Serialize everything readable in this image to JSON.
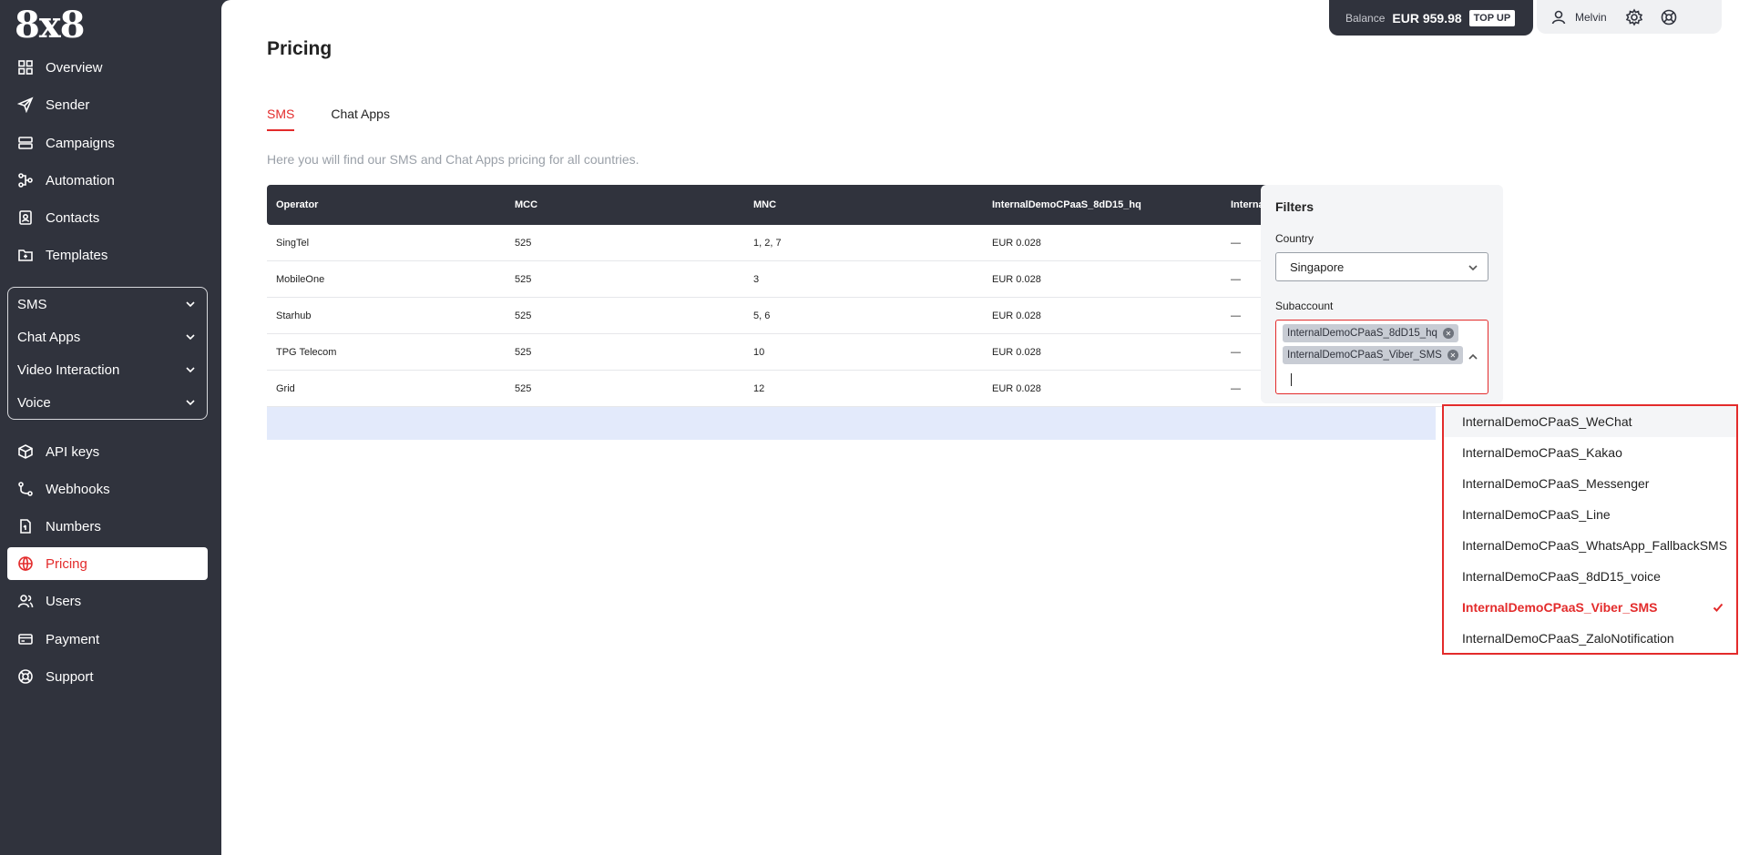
{
  "app": {
    "logo": "8x8"
  },
  "sidebar": {
    "items": [
      {
        "label": "Overview",
        "icon": "grid-icon"
      },
      {
        "label": "Sender",
        "icon": "send-icon"
      },
      {
        "label": "Campaigns",
        "icon": "campaign-icon"
      },
      {
        "label": "Automation",
        "icon": "automation-icon"
      },
      {
        "label": "Contacts",
        "icon": "contacts-icon"
      },
      {
        "label": "Templates",
        "icon": "templates-icon"
      }
    ],
    "groups": [
      "SMS",
      "Chat Apps",
      "Video Interaction",
      "Voice"
    ],
    "items_bottom": [
      {
        "label": "API keys",
        "icon": "cube-icon"
      },
      {
        "label": "Webhooks",
        "icon": "webhook-icon"
      },
      {
        "label": "Numbers",
        "icon": "numbers-icon"
      },
      {
        "label": "Pricing",
        "icon": "globe-icon",
        "active": true
      },
      {
        "label": "Users",
        "icon": "users-icon"
      },
      {
        "label": "Payment",
        "icon": "card-icon"
      },
      {
        "label": "Support",
        "icon": "support-icon"
      }
    ]
  },
  "topbar": {
    "balance_label": "Balance",
    "balance_value": "EUR 959.98",
    "topup_label": "TOP UP",
    "user_name": "Melvin"
  },
  "page": {
    "title": "Pricing",
    "tabs": [
      {
        "label": "SMS",
        "active": true
      },
      {
        "label": "Chat Apps",
        "active": false
      }
    ],
    "subtitle": "Here you will find our SMS and Chat Apps pricing for all countries."
  },
  "table": {
    "columns": [
      "Operator",
      "MCC",
      "MNC",
      "InternalDemoCPaaS_8dD15_hq",
      "InternalDemoCPaaS_Viber_SMS"
    ],
    "rows": [
      [
        "SingTel",
        "525",
        "1, 2, 7",
        "EUR 0.028",
        "—"
      ],
      [
        "MobileOne",
        "525",
        "3",
        "EUR 0.028",
        "—"
      ],
      [
        "Starhub",
        "525",
        "5, 6",
        "EUR 0.028",
        "—"
      ],
      [
        "TPG Telecom",
        "525",
        "10",
        "EUR 0.028",
        "—"
      ],
      [
        "Grid",
        "525",
        "12",
        "EUR 0.028",
        "—"
      ]
    ]
  },
  "filters": {
    "title": "Filters",
    "country_label": "Country",
    "country_value": "Singapore",
    "subaccount_label": "Subaccount",
    "subaccount_chips": [
      "InternalDemoCPaaS_8dD15_hq",
      "InternalDemoCPaaS_Viber_SMS"
    ]
  },
  "dropdown": {
    "options": [
      {
        "label": "InternalDemoCPaaS_WeChat",
        "state": "hover"
      },
      {
        "label": "InternalDemoCPaaS_Kakao",
        "state": ""
      },
      {
        "label": "InternalDemoCPaaS_Messenger",
        "state": ""
      },
      {
        "label": "InternalDemoCPaaS_Line",
        "state": ""
      },
      {
        "label": "InternalDemoCPaaS_WhatsApp_FallbackSMS",
        "state": ""
      },
      {
        "label": "InternalDemoCPaaS_8dD15_voice",
        "state": ""
      },
      {
        "label": "InternalDemoCPaaS_Viber_SMS",
        "state": "selected"
      },
      {
        "label": "InternalDemoCPaaS_ZaloNotification",
        "state": ""
      }
    ]
  },
  "colors": {
    "accent": "#e32b2b",
    "sidebar": "#30333d",
    "highlight_row": "#e3eafb"
  }
}
